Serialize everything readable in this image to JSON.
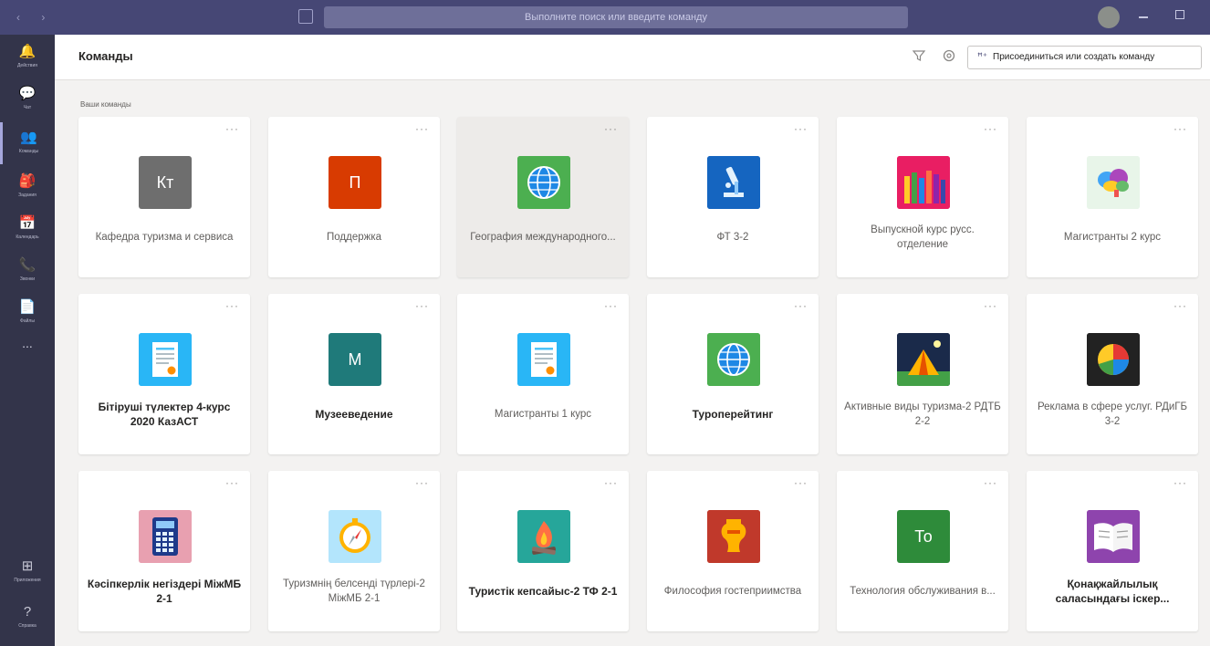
{
  "titlebar": {
    "nav_arrows": "‹ ›",
    "search_placeholder": "Выполните поиск или введите команду",
    "minimize_glyph": "—",
    "maximize_glyph": "□"
  },
  "rail": {
    "items": [
      {
        "label": "Действия",
        "icon": "bell-icon",
        "glyph": "🔔"
      },
      {
        "label": "Чат",
        "icon": "chat-icon",
        "glyph": "💬"
      },
      {
        "label": "Команды",
        "icon": "teams-icon",
        "glyph": "👥"
      },
      {
        "label": "Задания",
        "icon": "assignments-icon",
        "glyph": "🎒"
      },
      {
        "label": "Календарь",
        "icon": "calendar-icon",
        "glyph": "📅"
      },
      {
        "label": "Звонки",
        "icon": "phone-icon",
        "glyph": "📞"
      },
      {
        "label": "Файлы",
        "icon": "files-icon",
        "glyph": "📄"
      }
    ],
    "more": "...",
    "bottom": [
      {
        "label": "Приложения",
        "icon": "apps-icon",
        "glyph": "⊞"
      },
      {
        "label": "Справка",
        "icon": "help-icon",
        "glyph": "?"
      }
    ]
  },
  "header": {
    "title": "Команды",
    "join_button": "Присоединиться или создать команду"
  },
  "section_label": "Ваши команды",
  "more_glyph": "···",
  "colors": {
    "titlebar": "#464775",
    "rail": "#33344a",
    "accent": "#6264a7",
    "background": "#f3f2f1"
  },
  "teams": [
    {
      "name": "Кафедра туризма и сервиса",
      "logo": "initials",
      "text": "Кт",
      "color": "#6e6e6e",
      "bold": false
    },
    {
      "name": "Поддержка",
      "logo": "initials",
      "text": "П",
      "color": "#d83b01",
      "bold": false
    },
    {
      "name": "География международного...",
      "logo": "globe",
      "color": "#4caf50",
      "bold": false
    },
    {
      "name": "ФТ 3-2",
      "logo": "microscope",
      "color": "#1565c0",
      "bold": false
    },
    {
      "name": "Выпускной курс русс. отделение",
      "logo": "pencils",
      "color": "#e91e63",
      "bold": false
    },
    {
      "name": "Магистранты 2 курс",
      "logo": "brain",
      "color": "#e8f5e9",
      "bold": false
    },
    {
      "name": "Бітіруші түлектер 4-курс 2020 КазАСТ",
      "logo": "certificate",
      "color": "#29b6f6",
      "bold": true
    },
    {
      "name": "Музееведение",
      "logo": "initials",
      "text": "М",
      "color": "#1f7a7a",
      "bold": true
    },
    {
      "name": "Магистранты 1 курс",
      "logo": "certificate",
      "color": "#29b6f6",
      "bold": false
    },
    {
      "name": "Туроперейтинг",
      "logo": "globe",
      "color": "#4caf50",
      "bold": true
    },
    {
      "name": "Активные виды туризма-2 РДТБ 2-2",
      "logo": "tent",
      "color": "#1a2a4a",
      "bold": false
    },
    {
      "name": "Реклама в сфере услуг. РДиГБ 3-2",
      "logo": "piechart",
      "color": "#222222",
      "bold": false
    },
    {
      "name": "Кәсіпкерлік негіздері МіжМБ 2-1",
      "logo": "calculator",
      "color": "#e8a0b0",
      "bold": true
    },
    {
      "name": "Туризмнің белсенді түрлері-2 МіжМБ 2-1",
      "logo": "compass",
      "color": "#b3e5fc",
      "bold": false
    },
    {
      "name": "Туристік кепсайыс-2 ТФ 2-1",
      "logo": "campfire",
      "color": "#26a69a",
      "bold": true
    },
    {
      "name": "Философия гостеприимства",
      "logo": "vase",
      "color": "#c0392b",
      "bold": false
    },
    {
      "name": "Технология обслуживания в...",
      "logo": "initials",
      "text": "То",
      "color": "#2e8b3a",
      "bold": false
    },
    {
      "name": "Қонақжайлылық саласындағы іскер...",
      "logo": "book",
      "color": "#8e44ad",
      "bold": true
    }
  ]
}
